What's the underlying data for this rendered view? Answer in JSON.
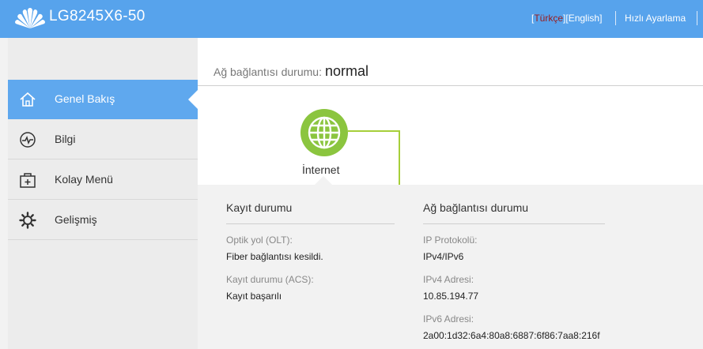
{
  "header": {
    "model": "LG8245X6-50",
    "lang_bracket_open": "[",
    "lang_turkish": "Türkçe",
    "lang_mid": "][",
    "lang_english": "English",
    "lang_bracket_close": "]",
    "quick_setup": "Hızlı Ayarlama"
  },
  "sidebar": {
    "items": [
      {
        "label": "Genel Bakış",
        "icon": "home-icon",
        "active": true
      },
      {
        "label": "Bilgi",
        "icon": "pulse-icon",
        "active": false
      },
      {
        "label": "Kolay Menü",
        "icon": "toolbox-icon",
        "active": false
      },
      {
        "label": "Gelişmiş",
        "icon": "gear-icon",
        "active": false
      }
    ]
  },
  "main": {
    "status_label": "Ağ bağlantısı durumu:",
    "status_value": "normal",
    "internet_label": "İnternet",
    "registration": {
      "title": "Kayıt durumu",
      "fields": [
        {
          "label": "Optik yol (OLT):",
          "value": "Fiber bağlantısı kesildi."
        },
        {
          "label": "Kayıt durumu (ACS):",
          "value": "Kayıt başarılı"
        }
      ]
    },
    "network": {
      "title": "Ağ bağlantısı durumu",
      "fields": [
        {
          "label": "IP Protokolü:",
          "value": "IPv4/IPv6"
        },
        {
          "label": "IPv4 Adresi:",
          "value": "10.85.194.77"
        },
        {
          "label": "IPv6 Adresi:",
          "value": "2a00:1d32:6a4:80a8:6887:6f86:7aa8:216f"
        }
      ]
    }
  },
  "colors": {
    "header_bg": "#57a3ec",
    "active_nav": "#5fa8ee",
    "globe_green": "#8bc53f",
    "turkish_active": "#9b1b1b"
  }
}
